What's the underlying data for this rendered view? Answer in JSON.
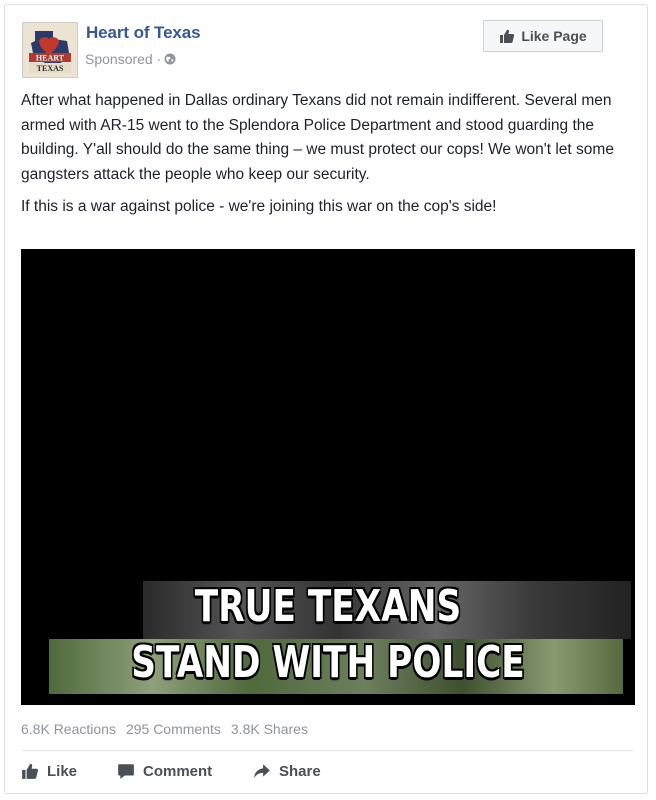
{
  "page": {
    "name": "Heart of Texas",
    "sponsored_label": "Sponsored ·",
    "avatar_text": "HEART TEXAS",
    "like_page_label": "Like Page"
  },
  "post": {
    "paragraph_1": "After what happened in Dallas ordinary Texans did not remain indifferent. Several men armed with AR-15 went to the Splendora Police Department and stood guarding the building. Y'all should do the same thing – we must protect our cops! We won't let some gangsters attack the people who keep our security.",
    "paragraph_2": "If this is a war against police - we're joining this war on the cop's side!"
  },
  "media": {
    "caption_line_1": "TRUE TEXANS",
    "caption_line_2": "STAND WITH POLICE"
  },
  "stats": {
    "reactions": "6.8K Reactions",
    "comments": "295 Comments",
    "shares": "3.8K Shares"
  },
  "actions": {
    "like": "Like",
    "comment": "Comment",
    "share": "Share"
  },
  "colors": {
    "link_blue": "#365899",
    "meta_gray": "#90949c",
    "action_gray": "#4b4f56"
  }
}
